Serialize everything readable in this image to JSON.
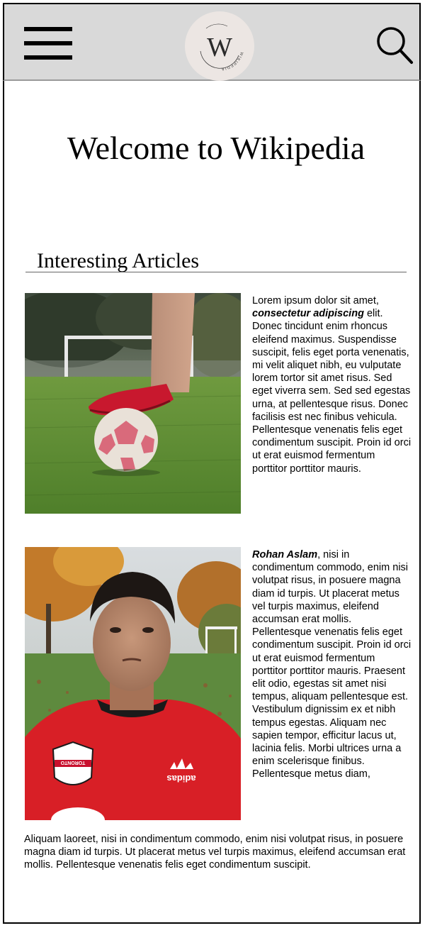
{
  "header": {
    "menu_icon": "hamburger-menu-icon",
    "logo_letter": "W",
    "logo_ring_text": "WIKIPEDIA",
    "search_icon": "magnifier-search-icon",
    "background": "#d9d9d9"
  },
  "page_title": "Welcome to Wikipedia",
  "section": {
    "title": "Interesting Articles"
  },
  "articles": [
    {
      "image_alt": "Red cleat resting on a soccer ball on a grass field with goal in background",
      "lead": "Lorem ipsum dolor sit amet, ",
      "emphasis": "consectetur adipiscing",
      "body": " elit. Donec tincidunt enim rhoncus eleifend maximus. Suspendisse suscipit, felis eget porta venenatis, mi velit aliquet nibh, eu vulputate lorem tortor sit amet risus. Sed eget viverra sem. Sed sed egestas urna, at pellentesque risus. Donec facilisis est nec finibus vehicula. Pellentesque venenatis felis eget condimentum suscipit. Proin id orci ut erat euismod fermentum porttitor porttitor mauris."
    },
    {
      "image_alt": "Portrait of a young man in a red Toronto FC jersey in an autumn park",
      "lead": "",
      "emphasis": "Rohan Aslam",
      "body": ", nisi in condimentum commodo, enim nisi volutpat risus, in posuere magna diam id turpis. Ut placerat metus vel turpis maximus, eleifend accumsan erat mollis. Pellentesque venenatis felis eget condimentum suscipit. Proin id orci ut erat euismod fermentum porttitor porttitor mauris. Praesent elit odio, egestas sit amet nisi tempus, aliquam pellentesque est. Vestibulum dignissim ex et nibh tempus egestas. Aliquam nec sapien tempor, efficitur lacus ut, lacinia felis. Morbi ultrices urna a enim scelerisque finibus. Pellentesque metus diam,"
    }
  ],
  "continuation_text": "Aliquam laoreet, nisi in condimentum commodo, enim nisi volutpat risus, in posuere magna diam id turpis. Ut placerat metus vel turpis maximus, eleifend accumsan erat mollis. Pellentesque venenatis felis eget condimentum suscipit.",
  "jersey": {
    "badge_text": "TORONTO",
    "brand_text": "adidas"
  }
}
